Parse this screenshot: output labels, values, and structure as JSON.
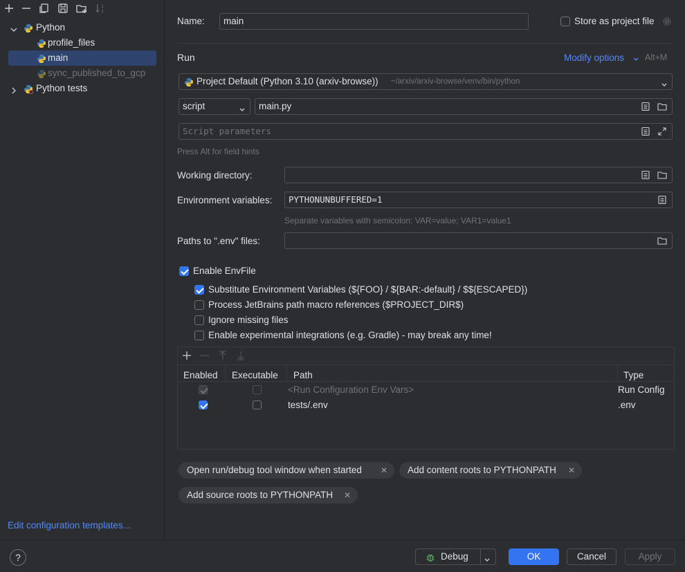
{
  "left_toolbar": {
    "icons": [
      "add-icon",
      "remove-icon",
      "copy-icon",
      "save-icon",
      "new-folder-icon",
      "sort-icon"
    ]
  },
  "tree": {
    "python_group": "Python",
    "items": [
      "profile_files",
      "main",
      "sync_published_to_gcp"
    ],
    "python_tests_group": "Python tests"
  },
  "edit_templates_link": "Edit configuration templates...",
  "name_label": "Name:",
  "name_value": "main",
  "store_project_file_label": "Store as project file",
  "run_section": "Run",
  "modify_options": "Modify options",
  "modify_shortcut": "Alt+M",
  "interpreter": {
    "name": "Project Default (Python 3.10 (arxiv-browse))",
    "path": "~/arxiv/arxiv-browse/venv/bin/python"
  },
  "target_type": "script",
  "script_path": "main.py",
  "script_params_placeholder": "Script parameters",
  "field_hint": "Press Alt for field hints",
  "working_dir_label": "Working directory:",
  "working_dir_value": "",
  "env_vars_label": "Environment variables:",
  "env_vars_value": "PYTHONUNBUFFERED=1",
  "env_vars_hint": "Separate variables with semicolon: VAR=value; VAR1=value1",
  "env_files_label": "Paths to \".env\" files:",
  "env_files_value": "",
  "envfile": {
    "enable_label": "Enable EnvFile",
    "enable_checked": true,
    "options": [
      {
        "label": "Substitute Environment Variables (${FOO} / ${BAR:-default} / $${ESCAPED})",
        "checked": true
      },
      {
        "label": "Process JetBrains path macro references ($PROJECT_DIR$)",
        "checked": false
      },
      {
        "label": "Ignore missing files",
        "checked": false
      },
      {
        "label": "Enable experimental integrations (e.g. Gradle) - may break any time!",
        "checked": false
      }
    ]
  },
  "table": {
    "toolbar_icons": [
      "add-icon",
      "remove-icon",
      "move-up-icon",
      "move-down-icon"
    ],
    "headers": [
      "Enabled",
      "Executable",
      "Path",
      "Type"
    ],
    "rows": [
      {
        "enabled": true,
        "executable": false,
        "path": "<Run Configuration Env Vars>",
        "type": "Run Config",
        "disabled": true
      },
      {
        "enabled": true,
        "executable": false,
        "path": "tests/.env",
        "type": ".env",
        "disabled": false
      }
    ]
  },
  "chips": [
    "Open run/debug tool window when started",
    "Add content roots to PYTHONPATH",
    "Add source roots to PYTHONPATH"
  ],
  "buttons": {
    "help": "?",
    "debug": "Debug",
    "ok": "OK",
    "cancel": "Cancel",
    "apply": "Apply"
  },
  "colors": {
    "accent": "#3574f0",
    "link": "#548af7",
    "background": "#2b2d30",
    "selection": "#2e436e"
  }
}
